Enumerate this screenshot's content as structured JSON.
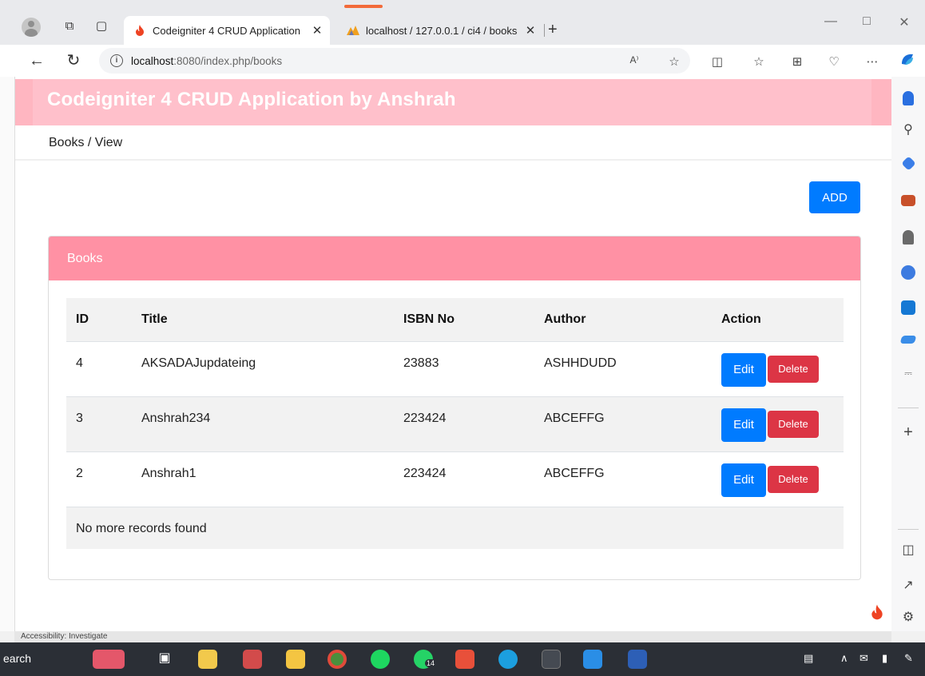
{
  "browser": {
    "tabs": [
      {
        "title": "Codeigniter 4 CRUD Application",
        "active": true
      },
      {
        "title": "localhost / 127.0.0.1 / ci4 / books",
        "active": false
      }
    ],
    "url_host": "localhost",
    "url_path": ":8080/index.php/books",
    "read_aloud": "A⁾",
    "more": "⋯"
  },
  "page": {
    "app_title": "Codeigniter 4 CRUD Application by Anshrah",
    "breadcrumb": "Books / View",
    "add_label": "ADD",
    "card_title": "Books",
    "columns": [
      "ID",
      "Title",
      "ISBN No",
      "Author",
      "Action"
    ],
    "rows": [
      {
        "id": "4",
        "title": "AKSADAJupdateing",
        "isbn": "23883",
        "author": "ASHHDUDD"
      },
      {
        "id": "3",
        "title": "Anshrah234",
        "isbn": "223424",
        "author": "ABCEFFG"
      },
      {
        "id": "2",
        "title": "Anshrah1",
        "isbn": "223424",
        "author": "ABCEFFG"
      }
    ],
    "edit_label": "Edit",
    "delete_label": "Delete",
    "no_more": "No more records found"
  },
  "taskbar": {
    "search_text": "earch",
    "status_text": "Accessibility: Investigate",
    "spotify_badge": "14"
  },
  "colors": {
    "header_pink": "#ffc0cb",
    "card_header_pink": "#ff91a4",
    "primary_blue": "#007bff",
    "danger_red": "#dc3545"
  }
}
